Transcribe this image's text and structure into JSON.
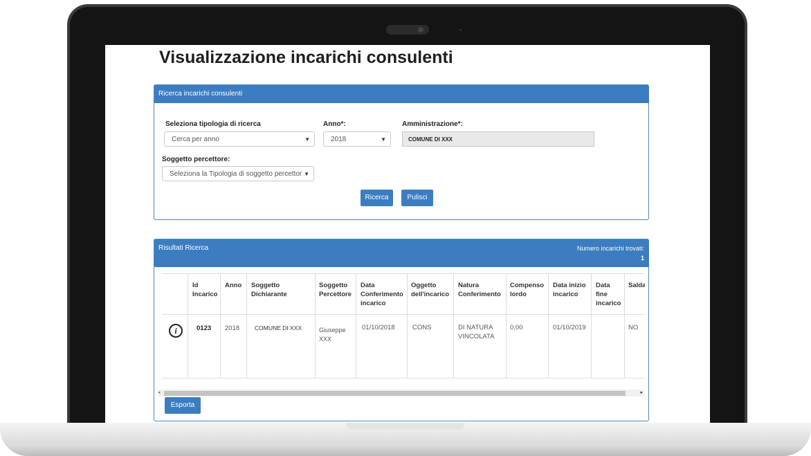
{
  "page": {
    "title": "Visualizzazione incarichi consulenti"
  },
  "search": {
    "header": "Ricerca incarichi consulenti",
    "type_label": "Seleziona tipologia di ricerca",
    "type_value": "Cerca per anno",
    "year_label": "Anno*:",
    "year_value": "2018",
    "admin_label": "Amministrazione*:",
    "admin_value": "COMUNE DI XXX",
    "recipient_label": "Soggetto percettore:",
    "recipient_value": "Seleziona la Tipologia di soggetto percettore",
    "search_button": "Ricerca",
    "clear_button": "Pulisci",
    "arrow": "▼"
  },
  "results": {
    "header": "Risultati Ricerca",
    "count_label": "Numero incarichi trovati:",
    "count_value": "1",
    "columns": [
      "Id Incarico",
      "Anno",
      "Soggetto Dichiarante",
      "Soggetto Percettore",
      "Data Conferimento incarico",
      "Oggetto dell'incarico",
      "Natura Conferimento",
      "Compenso lordo",
      "Data inizio incarico",
      "Data fine incarico",
      "Saldato"
    ],
    "row": [
      "0123",
      "2018",
      "COMUNE DI XXX",
      "Giuseppe XXX",
      "01/10/2018",
      "CONS",
      "DI NATURA VINCOLATA",
      "0,00",
      "01/10/2019",
      "",
      "NO"
    ],
    "info_icon": "i",
    "export_button": "Esporta",
    "scroll_left": "◂",
    "scroll_right": "▸"
  }
}
